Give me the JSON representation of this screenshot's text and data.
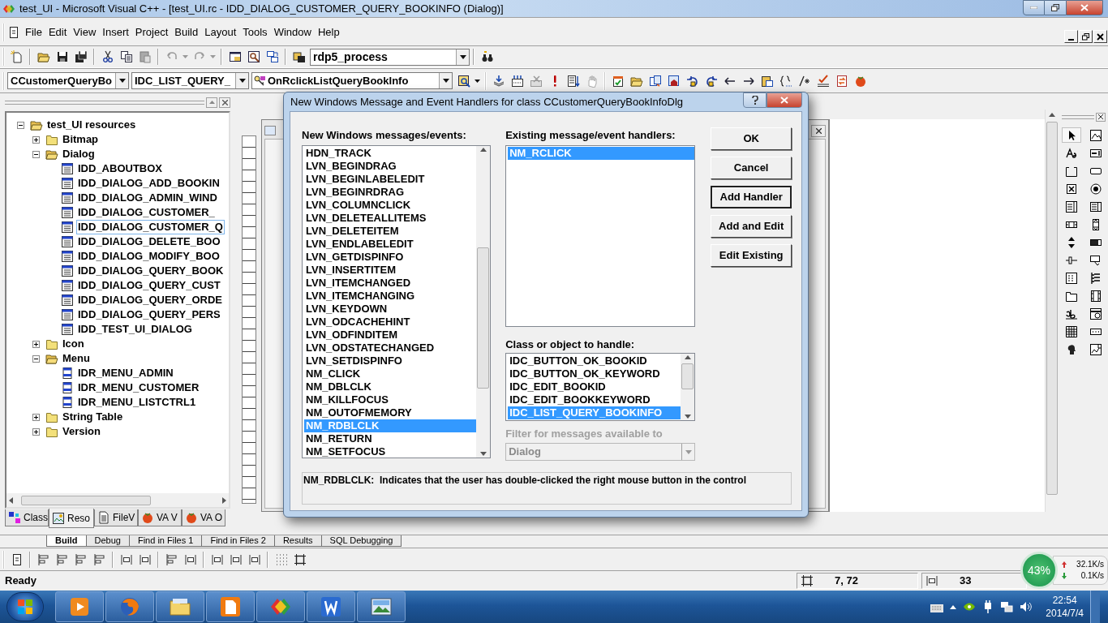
{
  "window": {
    "title": "test_UI - Microsoft Visual C++ - [test_UI.rc - IDD_DIALOG_CUSTOMER_QUERY_BOOKINFO (Dialog)]"
  },
  "menu": [
    "File",
    "Edit",
    "View",
    "Insert",
    "Project",
    "Build",
    "Layout",
    "Tools",
    "Window",
    "Help"
  ],
  "toolbar": {
    "config_combo": "rdp5_process"
  },
  "wizard_bar": {
    "class_combo": "CCustomerQueryBo",
    "id_combo": "IDC_LIST_QUERY_",
    "handler_combo": "OnRclickListQueryBookInfo"
  },
  "workspace": {
    "tree": [
      {
        "label": "test_UI resources",
        "kind": "root",
        "expanded": true,
        "children": [
          {
            "label": "Bitmap",
            "kind": "folder",
            "expanded": false
          },
          {
            "label": "Dialog",
            "kind": "folder",
            "expanded": true,
            "children": [
              {
                "label": "IDD_ABOUTBOX",
                "kind": "dialog",
                "selected": false
              },
              {
                "label": "IDD_DIALOG_ADD_BOOKIN",
                "kind": "dialog",
                "selected": false
              },
              {
                "label": "IDD_DIALOG_ADMIN_WIND",
                "kind": "dialog",
                "selected": false
              },
              {
                "label": "IDD_DIALOG_CUSTOMER_",
                "kind": "dialog",
                "selected": false
              },
              {
                "label": "IDD_DIALOG_CUSTOMER_Q",
                "kind": "dialog",
                "selected": true
              },
              {
                "label": "IDD_DIALOG_DELETE_BOO",
                "kind": "dialog",
                "selected": false
              },
              {
                "label": "IDD_DIALOG_MODIFY_BOO",
                "kind": "dialog",
                "selected": false
              },
              {
                "label": "IDD_DIALOG_QUERY_BOOK",
                "kind": "dialog",
                "selected": false
              },
              {
                "label": "IDD_DIALOG_QUERY_CUST",
                "kind": "dialog",
                "selected": false
              },
              {
                "label": "IDD_DIALOG_QUERY_ORDE",
                "kind": "dialog",
                "selected": false
              },
              {
                "label": "IDD_DIALOG_QUERY_PERS",
                "kind": "dialog",
                "selected": false
              },
              {
                "label": "IDD_TEST_UI_DIALOG",
                "kind": "dialog",
                "selected": false
              }
            ]
          },
          {
            "label": "Icon",
            "kind": "folder",
            "expanded": false
          },
          {
            "label": "Menu",
            "kind": "folder",
            "expanded": true,
            "children": [
              {
                "label": "IDR_MENU_ADMIN",
                "kind": "menu",
                "selected": false
              },
              {
                "label": "IDR_MENU_CUSTOMER",
                "kind": "menu",
                "selected": false
              },
              {
                "label": "IDR_MENU_LISTCTRL1",
                "kind": "menu",
                "selected": false
              }
            ]
          },
          {
            "label": "String Table",
            "kind": "folder",
            "expanded": false
          },
          {
            "label": "Version",
            "kind": "folder",
            "expanded": false
          }
        ]
      }
    ],
    "tabs": [
      {
        "label": "Class",
        "selected": false
      },
      {
        "label": "Reso",
        "selected": true
      },
      {
        "label": "FileV",
        "selected": false
      },
      {
        "label": "VA V",
        "selected": false
      },
      {
        "label": "VA O",
        "selected": false
      }
    ]
  },
  "dialog": {
    "title": "New Windows Message and Event Handlers for class CCustomerQueryBookInfoDlg",
    "messages_label": "New Windows messages/events:",
    "messages": [
      {
        "label": "HDN_TRACK",
        "selected": false
      },
      {
        "label": "LVN_BEGINDRAG",
        "selected": false
      },
      {
        "label": "LVN_BEGINLABELEDIT",
        "selected": false
      },
      {
        "label": "LVN_BEGINRDRAG",
        "selected": false
      },
      {
        "label": "LVN_COLUMNCLICK",
        "selected": false
      },
      {
        "label": "LVN_DELETEALLITEMS",
        "selected": false
      },
      {
        "label": "LVN_DELETEITEM",
        "selected": false
      },
      {
        "label": "LVN_ENDLABELEDIT",
        "selected": false
      },
      {
        "label": "LVN_GETDISPINFO",
        "selected": false
      },
      {
        "label": "LVN_INSERTITEM",
        "selected": false
      },
      {
        "label": "LVN_ITEMCHANGED",
        "selected": false
      },
      {
        "label": "LVN_ITEMCHANGING",
        "selected": false
      },
      {
        "label": "LVN_KEYDOWN",
        "selected": false
      },
      {
        "label": "LVN_ODCACHEHINT",
        "selected": false
      },
      {
        "label": "LVN_ODFINDITEM",
        "selected": false
      },
      {
        "label": "LVN_ODSTATECHANGED",
        "selected": false
      },
      {
        "label": "LVN_SETDISPINFO",
        "selected": false
      },
      {
        "label": "NM_CLICK",
        "selected": false
      },
      {
        "label": "NM_DBLCLK",
        "selected": false
      },
      {
        "label": "NM_KILLFOCUS",
        "selected": false
      },
      {
        "label": "NM_OUTOFMEMORY",
        "selected": false
      },
      {
        "label": "NM_RDBLCLK",
        "selected": true
      },
      {
        "label": "NM_RETURN",
        "selected": false
      },
      {
        "label": "NM_SETFOCUS",
        "selected": false
      }
    ],
    "handlers_label": "Existing message/event handlers:",
    "handlers": [
      {
        "label": "NM_RCLICK",
        "selected": true
      }
    ],
    "class_label": "Class or object to handle:",
    "classes": [
      {
        "label": "IDC_BUTTON_OK_BOOKID",
        "selected": false
      },
      {
        "label": "IDC_BUTTON_OK_KEYWORD",
        "selected": false
      },
      {
        "label": "IDC_EDIT_BOOKID",
        "selected": false
      },
      {
        "label": "IDC_EDIT_BOOKKEYWORD",
        "selected": false
      },
      {
        "label": "IDC_LIST_QUERY_BOOKINFO",
        "selected": true
      }
    ],
    "filter_label": "Filter for messages available to",
    "filter": {
      "value": "Dialog",
      "disabled": true
    },
    "buttons": [
      {
        "label": "OK",
        "default": false
      },
      {
        "label": "Cancel",
        "default": false
      },
      {
        "label": "Add Handler",
        "default": true
      },
      {
        "label": "Add and Edit",
        "default": false
      },
      {
        "label": "Edit Existing",
        "default": false
      }
    ],
    "description": "NM_RDBLCLK:  Indicates that the user has double-clicked the right mouse button in the control"
  },
  "output_tabs": [
    {
      "label": "Build",
      "selected": true
    },
    {
      "label": "Debug",
      "selected": false
    },
    {
      "label": "Find in Files 1",
      "selected": false
    },
    {
      "label": "Find in Files 2",
      "selected": false
    },
    {
      "label": "Results",
      "selected": false
    },
    {
      "label": "SQL Debugging",
      "selected": false
    }
  ],
  "status_bar": {
    "text": "Ready",
    "position": "7, 72",
    "size": "33"
  },
  "network_widget": {
    "percent": "43%",
    "upload": "32.1K/s",
    "download": "0.1K/s"
  },
  "taskbar": {
    "time": "22:54",
    "date": "2014/7/4"
  }
}
